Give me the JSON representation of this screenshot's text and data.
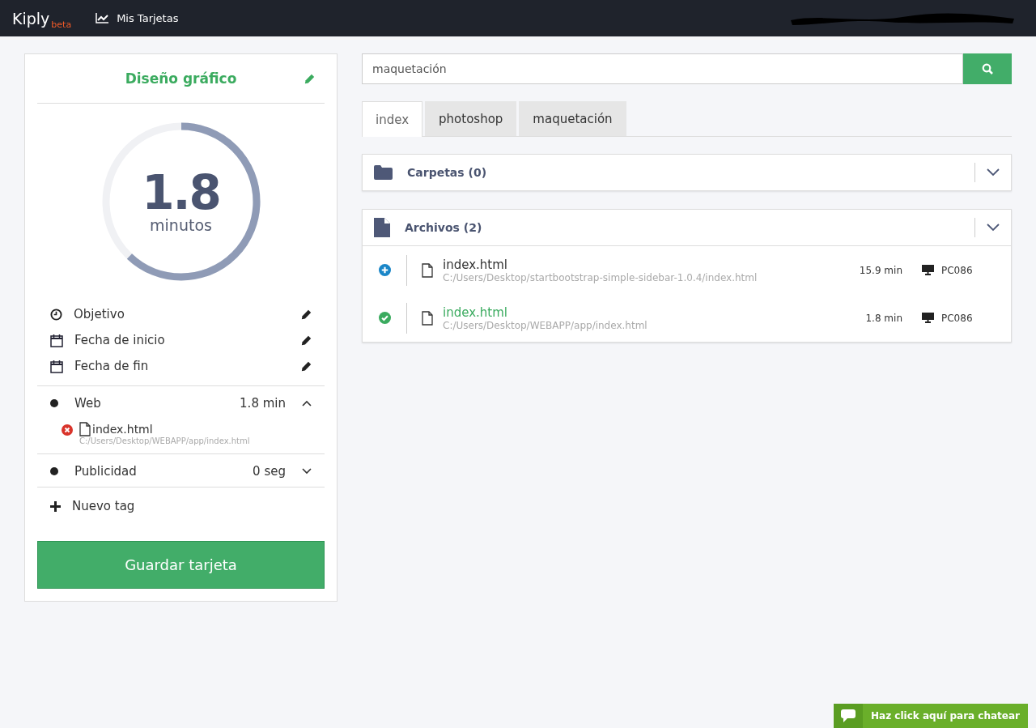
{
  "navbar": {
    "logo": "Kiply",
    "logo_badge": "beta",
    "links": [
      {
        "label": "Mis Tarjetas"
      }
    ]
  },
  "card": {
    "title": "Diseño gráfico",
    "gauge": {
      "value": "1.8",
      "unit": "minutos",
      "level": 0.62
    },
    "fields": [
      {
        "kind": "clock",
        "label": "Objetivo"
      },
      {
        "kind": "calendar",
        "label": "Fecha de inicio"
      },
      {
        "kind": "calendar",
        "label": "Fecha de fin"
      }
    ],
    "tags": [
      {
        "name": "Web",
        "time": "1.8 min",
        "expanded": true,
        "files": [
          {
            "kind": "error",
            "name": "index.html",
            "path": "C:/Users/Desktop/WEBAPP/app/index.html"
          }
        ]
      },
      {
        "name": "Publicidad",
        "time": "0 seg",
        "expanded": false
      }
    ],
    "new_tag": "Nuevo tag",
    "save_button": "Guardar tarjeta"
  },
  "search": {
    "value": "maquetación"
  },
  "tabs": [
    {
      "label": "index",
      "selected": true
    },
    {
      "label": "photoshop",
      "selected": false
    },
    {
      "label": "maquetación",
      "selected": false
    }
  ],
  "sections": [
    {
      "kind": "folder",
      "title": "Carpetas (0)"
    },
    {
      "kind": "file",
      "title": "Archivos (2)",
      "files": [
        {
          "kind": "add",
          "name": "index.html",
          "path": "C:/Users/Desktop/startbootstrap-simple-sidebar-1.0.4/index.html",
          "time": "15.9 min",
          "device": "PC086"
        },
        {
          "kind": "done",
          "name": "index.html",
          "path": "C:/Users/Desktop/WEBAPP/app/index.html",
          "time": "1.8 min",
          "device": "PC086"
        }
      ]
    }
  ],
  "chat": {
    "label": "Haz click aquí para chatear"
  }
}
